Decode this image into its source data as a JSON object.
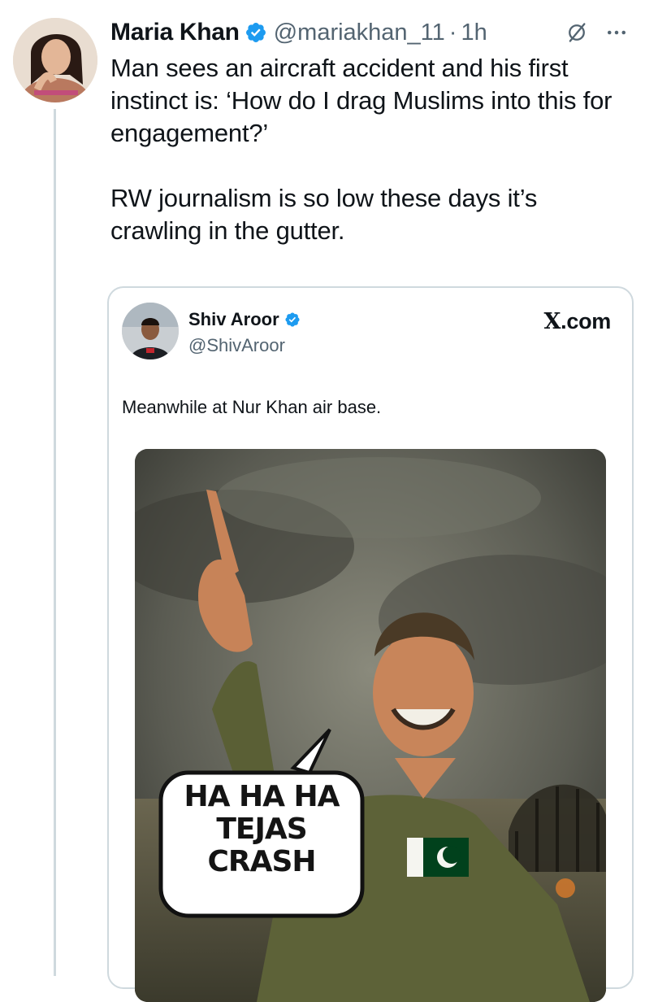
{
  "tweet": {
    "author_name": "Maria Khan",
    "handle": "@mariakhan_11",
    "separator": "·",
    "time": "1h",
    "paragraphs": [
      "Man sees an aircraft accident and his first instinct is: ‘How do I drag Muslims into this for engagement?’",
      "RW journalism is so low these days it’s crawling in the gutter."
    ]
  },
  "quoted_tweet": {
    "author_name": "Shiv Aroor",
    "handle": "@ShivAroor",
    "source_glyph": "X",
    "source_domain": ".com",
    "text": "Meanwhile at Nur Khan air base.",
    "image": {
      "speech_lines": [
        "HA HA HA",
        "TEJAS",
        "CRASH"
      ]
    }
  },
  "icons": {
    "verified": "verified-badge-icon",
    "grok": "grok-icon",
    "more": "more-options-icon"
  },
  "colors": {
    "verified_blue": "#1d9bf0",
    "secondary_text": "#536471",
    "border": "#cfd9de",
    "flag_green": "#01411c"
  }
}
